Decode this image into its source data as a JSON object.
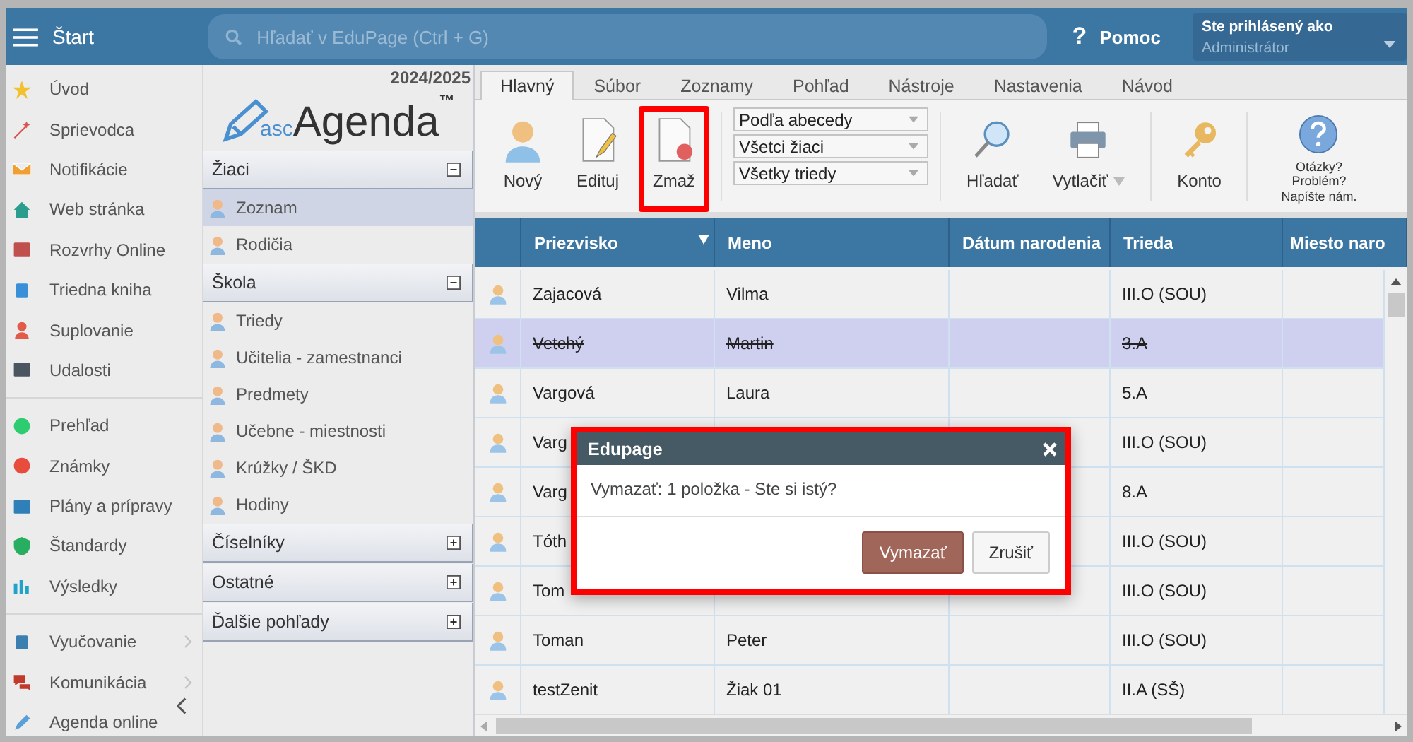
{
  "topbar": {
    "title": "Štart",
    "search": {
      "placeholder": "Hľadať v EduPage (Ctrl + G)"
    },
    "help_icon": "?",
    "help": "Pomoc",
    "user": {
      "label": "Ste prihlásený ako",
      "name": "Administrátor"
    }
  },
  "sidebar": {
    "groups": [
      [
        {
          "label": "Úvod",
          "submenu": false
        },
        {
          "label": "Sprievodca",
          "submenu": false
        },
        {
          "label": "Notifikácie",
          "submenu": false
        },
        {
          "label": "Web stránka",
          "submenu": false
        },
        {
          "label": "Rozvrhy Online",
          "submenu": false
        },
        {
          "label": "Triedna kniha",
          "submenu": false
        },
        {
          "label": "Suplovanie",
          "submenu": false
        },
        {
          "label": "Udalosti",
          "submenu": false
        }
      ],
      [
        {
          "label": "Prehľad",
          "submenu": false
        },
        {
          "label": "Známky",
          "submenu": false
        },
        {
          "label": "Plány a prípravy",
          "submenu": false
        },
        {
          "label": "Štandardy",
          "submenu": false
        },
        {
          "label": "Výsledky",
          "submenu": false
        }
      ],
      [
        {
          "label": "Vyučovanie",
          "submenu": true
        },
        {
          "label": "Komunikácia",
          "submenu": true
        },
        {
          "label": "Agenda online",
          "submenu": false
        }
      ]
    ]
  },
  "nav": {
    "year": "2024/2025",
    "logo": {
      "prefix": "asc",
      "name": "Agenda",
      "mark": "™"
    },
    "sections": [
      {
        "title": "Žiaci",
        "expanded": true,
        "items": [
          {
            "label": "Zoznam",
            "selected": true
          },
          {
            "label": "Rodičia",
            "selected": false
          }
        ]
      },
      {
        "title": "Škola",
        "expanded": true,
        "items": [
          {
            "label": "Triedy",
            "selected": false
          },
          {
            "label": "Učitelia - zamestnanci",
            "selected": false
          },
          {
            "label": "Predmety",
            "selected": false
          },
          {
            "label": "Učebne - miestnosti",
            "selected": false
          },
          {
            "label": "Krúžky / ŠKD",
            "selected": false
          },
          {
            "label": "Hodiny",
            "selected": false
          }
        ]
      },
      {
        "title": "Číselníky",
        "expanded": false
      },
      {
        "title": "Ostatné",
        "expanded": false
      },
      {
        "title": "Ďalšie pohľady",
        "expanded": false
      }
    ]
  },
  "tabs": [
    {
      "label": "Hlavný",
      "selected": true
    },
    {
      "label": "Súbor",
      "selected": false
    },
    {
      "label": "Zoznamy",
      "selected": false
    },
    {
      "label": "Pohľad",
      "selected": false
    },
    {
      "label": "Nástroje",
      "selected": false
    },
    {
      "label": "Nastavenia",
      "selected": false
    },
    {
      "label": "Návod",
      "selected": false
    }
  ],
  "toolbar": {
    "actions": [
      {
        "label": "Nový",
        "highlighted": false
      },
      {
        "label": "Edituj",
        "highlighted": false
      },
      {
        "label": "Zmaž",
        "highlighted": true
      }
    ],
    "filters": [
      "Podľa abecedy",
      "Všetci žiaci",
      "Všetky triedy"
    ],
    "tools": [
      {
        "label": "Hľadať",
        "dropdown": false
      },
      {
        "label": "Vytlačiť",
        "dropdown": true
      }
    ],
    "account": "Konto",
    "feedback": "Otázky? Problém? Napíšte nám."
  },
  "table": {
    "columns": [
      {
        "label": "Priezvisko",
        "sorted": true
      },
      {
        "label": "Meno",
        "sorted": false
      },
      {
        "label": "Dátum narodenia",
        "sorted": false
      },
      {
        "label": "Trieda",
        "sorted": false
      },
      {
        "label": "Miesto naro",
        "sorted": false
      }
    ],
    "rows": [
      {
        "surname": "Zajacová",
        "name": "Vilma",
        "class": "III.O (SOU)",
        "selected": false,
        "struck": false
      },
      {
        "surname": "Vetchý",
        "name": "Martin",
        "class": "3.A",
        "selected": true,
        "struck": true
      },
      {
        "surname": "Vargová",
        "name": "Laura",
        "class": "5.A",
        "selected": false,
        "struck": false
      },
      {
        "surname": "Varg",
        "class": "III.O (SOU)",
        "selected": false,
        "struck": false
      },
      {
        "surname": "Varg",
        "class": "8.A",
        "selected": false,
        "struck": false
      },
      {
        "surname": "Tóth",
        "class": "III.O (SOU)",
        "selected": false,
        "struck": false
      },
      {
        "surname": "Tom",
        "class": "III.O (SOU)",
        "selected": false,
        "struck": false
      },
      {
        "surname": "Toman",
        "name": "Peter",
        "class": "III.O (SOU)",
        "selected": false,
        "struck": false
      },
      {
        "surname": "testZenit",
        "name": "Žiak 01",
        "class": "II.A (SŠ)",
        "selected": false,
        "struck": false
      }
    ]
  },
  "dialog": {
    "title": "Edupage",
    "message": "Vymazať: 1 položka - Ste si istý?",
    "highlighted": true,
    "buttons": [
      {
        "label": "Vymazať",
        "kind": "primary"
      },
      {
        "label": "Zrušiť",
        "kind": "secondary"
      }
    ]
  }
}
